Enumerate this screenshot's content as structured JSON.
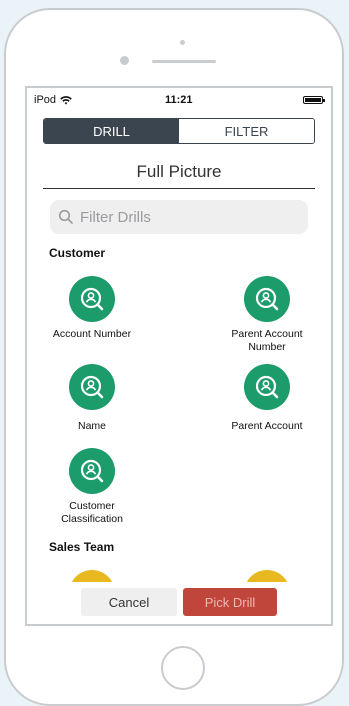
{
  "status_bar": {
    "carrier": "iPod",
    "time": "11:21"
  },
  "segments": {
    "drill": "DRILL",
    "filter": "FILTER"
  },
  "header": {
    "title": "Full Picture"
  },
  "search": {
    "placeholder": "Filter Drills"
  },
  "sections": [
    {
      "title": "Customer",
      "items": [
        {
          "label": "Account Number"
        },
        {
          "label": "Parent Account Number"
        },
        {
          "label": "Name"
        },
        {
          "label": "Parent Account"
        },
        {
          "label": "Customer Classification"
        }
      ]
    },
    {
      "title": "Sales Team",
      "items": []
    }
  ],
  "footer": {
    "cancel": "Cancel",
    "pick": "Pick Drill"
  },
  "colors": {
    "accent_green": "#1c9b6b",
    "accent_yellow": "#e8b820",
    "pick_button": "#c0453a",
    "segment_active": "#3a4550"
  },
  "icons": {
    "drill_icon": "user-search-icon",
    "search": "search-icon",
    "wifi": "wifi-icon",
    "battery": "battery-icon"
  }
}
